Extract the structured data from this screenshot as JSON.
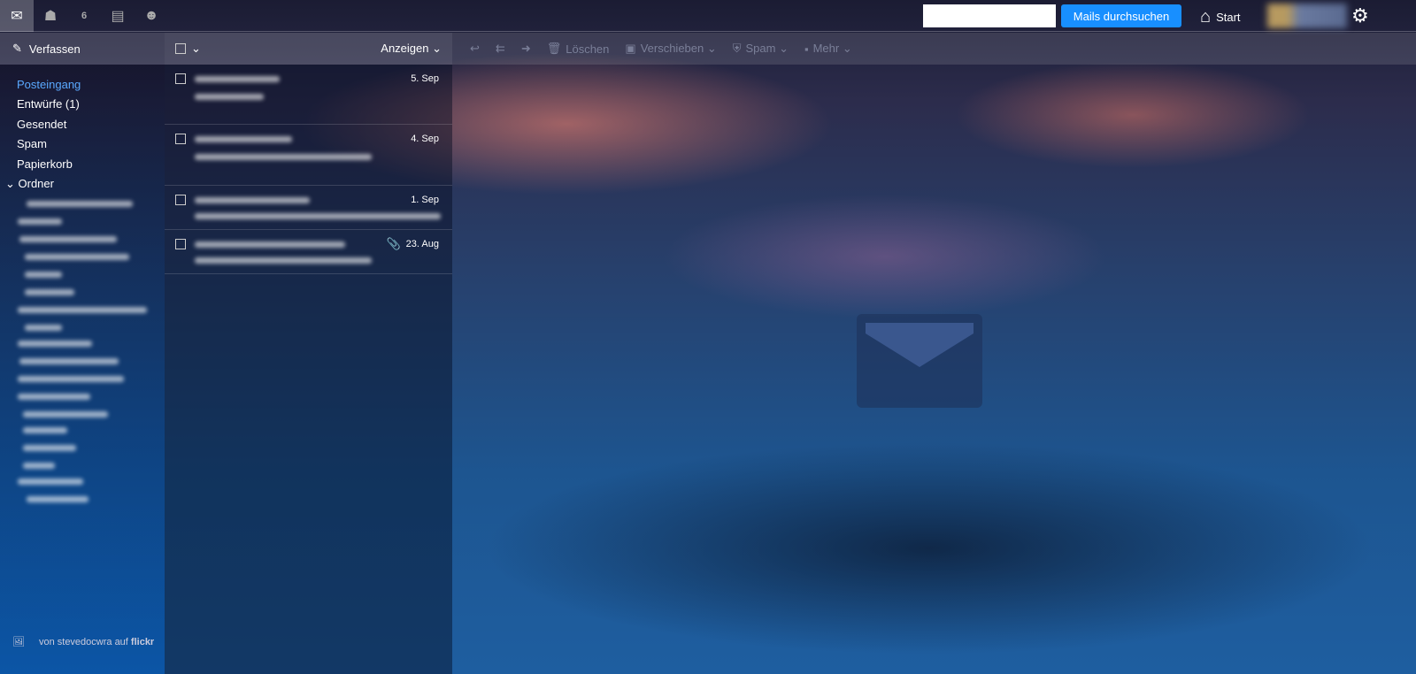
{
  "apps": [
    {
      "name": "mail-icon",
      "glyph": "✉"
    },
    {
      "name": "contacts-icon",
      "glyph": "☗"
    },
    {
      "name": "calendar-icon",
      "glyph": "6"
    },
    {
      "name": "notepad-icon",
      "glyph": "▤"
    },
    {
      "name": "messenger-icon",
      "glyph": "☻"
    }
  ],
  "header": {
    "search_button": "Mails durchsuchen",
    "start": "Start",
    "search_value": ""
  },
  "compose": "Verfassen",
  "listhead": {
    "view": "Anzeigen ⌄"
  },
  "toolbar": {
    "delete": "Löschen",
    "move": "Verschieben ⌄",
    "spam": "Spam ⌄",
    "more": "Mehr ⌄"
  },
  "folders": [
    "Posteingang",
    "Entwürfe (1)",
    "Gesendet",
    "Spam",
    "Papierkorb"
  ],
  "folders_group": "Ordner",
  "messages": [
    {
      "date": "5. Sep"
    },
    {
      "date": "4. Sep"
    },
    {
      "date": "1. Sep"
    },
    {
      "date": "23. Aug",
      "attachment": true
    }
  ],
  "credit": {
    "text": "von stevedocwra auf",
    "brand": "flickr"
  },
  "colors": {
    "accent": "#188fff",
    "active_folder": "#5aa9ff"
  }
}
